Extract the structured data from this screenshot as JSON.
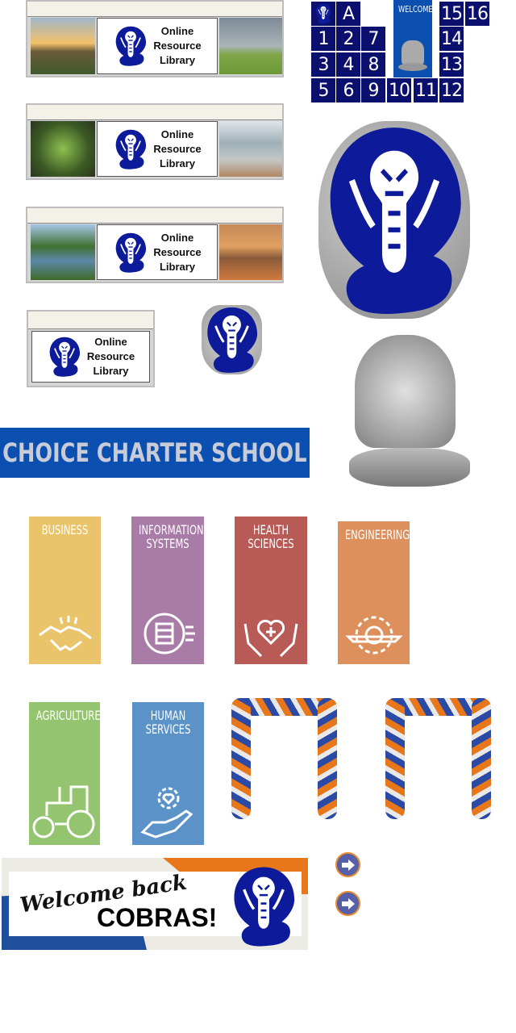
{
  "library_banners": [
    {
      "text": [
        "Online",
        "Resource",
        "Library"
      ],
      "left_image": "sunset-valley",
      "right_image": "rainbow-field"
    },
    {
      "text": [
        "Online",
        "Resource",
        "Library"
      ],
      "left_image": "sprouts",
      "right_image": "lake-meditation"
    },
    {
      "text": [
        "Online",
        "Resource",
        "Library"
      ],
      "left_image": "lake-trees",
      "right_image": "autumn-lake"
    },
    {
      "text": [
        "Online",
        "Resource",
        "Library"
      ]
    }
  ],
  "grid": {
    "cells": [
      "A",
      "1",
      "2",
      "7",
      "3",
      "4",
      "8",
      "5",
      "6",
      "9",
      "10",
      "11",
      "12",
      "13",
      "14",
      "15",
      "16"
    ],
    "welcome": "WELCOME",
    "cell_color": "#0b0f6e"
  },
  "school_banner": {
    "title": "CHOICE CHARTER SCHOOL",
    "color": "#0b4fb0"
  },
  "careers": [
    {
      "label": [
        "BUSINESS"
      ],
      "color": "#e9c46a",
      "icon": "handshake-icon"
    },
    {
      "label": [
        "INFORMATION",
        "SYSTEMS"
      ],
      "color": "#a97ca8",
      "icon": "gear-server-icon"
    },
    {
      "label": [
        "HEALTH",
        "SCIENCES"
      ],
      "color": "#b85a56",
      "icon": "heart-hands-icon"
    },
    {
      "label": [
        "ENGINEERING"
      ],
      "color": "#dd8f5c",
      "icon": "gear-pencil-icon"
    },
    {
      "label": [
        "AGRICULTURE"
      ],
      "color": "#94c46f",
      "icon": "tractor-icon"
    },
    {
      "label": [
        "HUMAN",
        "SERVICES"
      ],
      "color": "#5b93c9",
      "icon": "hand-heart-icon"
    }
  ],
  "welcome_banner": {
    "script": "Welcome back",
    "bold": "COBRAS!"
  },
  "colors": {
    "cobra_blue": "#0d1a9a",
    "orange": "#e8761a",
    "navy": "#1f4f9a"
  }
}
